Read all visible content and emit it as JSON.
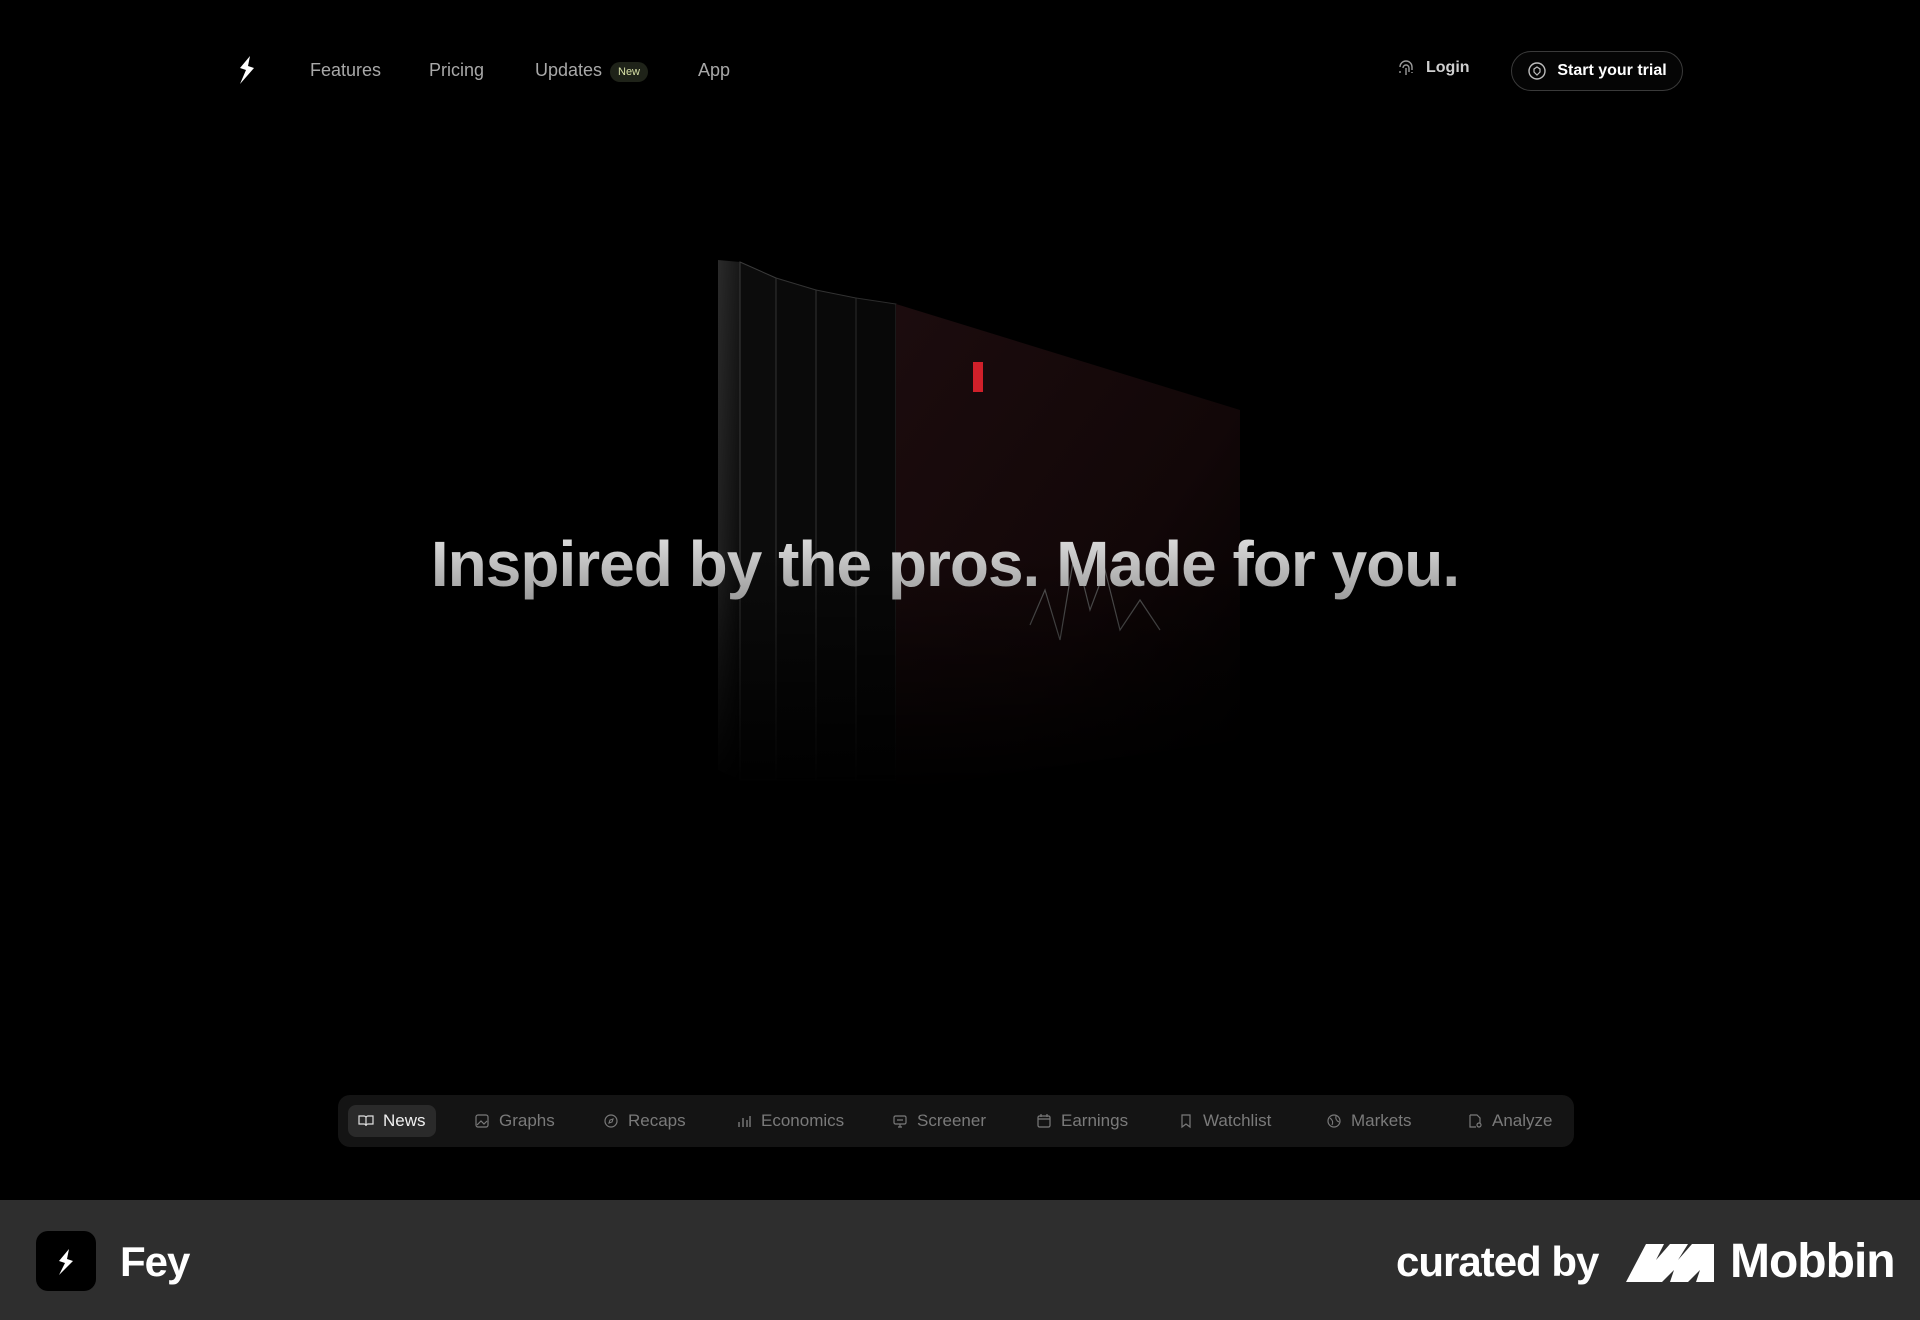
{
  "nav": {
    "features": "Features",
    "pricing": "Pricing",
    "updates": "Updates",
    "updates_badge": "New",
    "app": "App",
    "login": "Login",
    "trial": "Start your trial"
  },
  "hero": {
    "title": "Inspired by the pros. Made for you."
  },
  "tabs": [
    {
      "label": "News",
      "icon": "book-icon",
      "active": true
    },
    {
      "label": "Graphs",
      "icon": "image-icon"
    },
    {
      "label": "Recaps",
      "icon": "compass-icon"
    },
    {
      "label": "Economics",
      "icon": "bar-chart-icon"
    },
    {
      "label": "Screener",
      "icon": "screen-icon"
    },
    {
      "label": "Earnings",
      "icon": "calendar-icon"
    },
    {
      "label": "Watchlist",
      "icon": "bookmark-icon"
    },
    {
      "label": "Markets",
      "icon": "globe-icon"
    },
    {
      "label": "Analyze",
      "icon": "document-search-icon"
    }
  ],
  "footer": {
    "app_name": "Fey",
    "curated_by": "curated by",
    "brand": "Mobbin"
  }
}
